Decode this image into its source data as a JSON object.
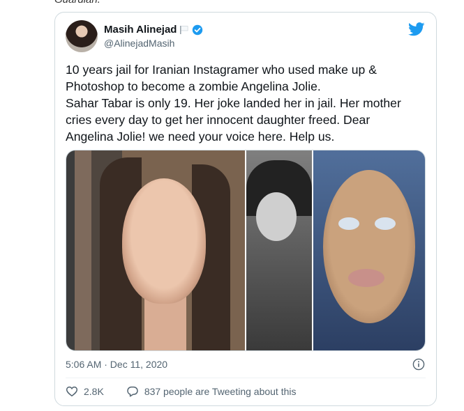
{
  "top_text": "Guardian.",
  "author": {
    "name": "Masih Alinejad",
    "handle": "@AlinejadMasih"
  },
  "tweet": {
    "text": "10 years jail for Iranian Instagramer who used make up &\nPhotoshop to become a zombie Angelina Jolie.\nSahar Tabar is only 19. Her joke landed her in jail. Her mother\ncries every day to get her innocent daughter freed. Dear\nAngelina Jolie!  we need your voice here. Help us.",
    "timestamp": "5:06 AM · Dec 11, 2020",
    "likes": "2.8K",
    "tweeting_about": "837 people are Tweeting about this"
  },
  "icons": {
    "twitter": "twitter-bird-icon",
    "verified": "verified-badge-icon",
    "flag": "white-flag-icon",
    "info": "info-icon",
    "like": "heart-icon",
    "reply": "reply-icon"
  },
  "colors": {
    "twitter_blue": "#1d9bf0",
    "secondary_text": "#536471",
    "border": "#cfd9de"
  }
}
